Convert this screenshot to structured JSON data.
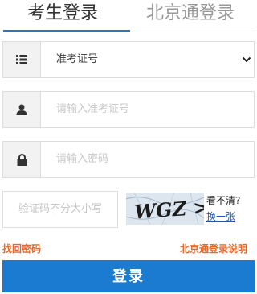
{
  "tabs": {
    "active_label": "考生登录",
    "inactive_label": "北京通登录"
  },
  "form": {
    "type_select": {
      "selected": "准考证号",
      "icon": "list-icon"
    },
    "ticket_field": {
      "placeholder": "请输入准考证号",
      "icon": "user-icon"
    },
    "password_field": {
      "placeholder": "请输入密码",
      "icon": "lock-icon"
    },
    "captcha_field": {
      "placeholder": "验证码不分大小写"
    }
  },
  "captcha": {
    "glyphs": "WGZ >",
    "help_label": "看不清?",
    "refresh_label": "换一张"
  },
  "links": {
    "forgot_password": "找回密码",
    "bjt_guide": "北京通登录说明"
  },
  "login_button": "登录",
  "colors": {
    "accent": "#3c6fa8",
    "link": "#e6682a",
    "button": "#1a7bd0"
  }
}
